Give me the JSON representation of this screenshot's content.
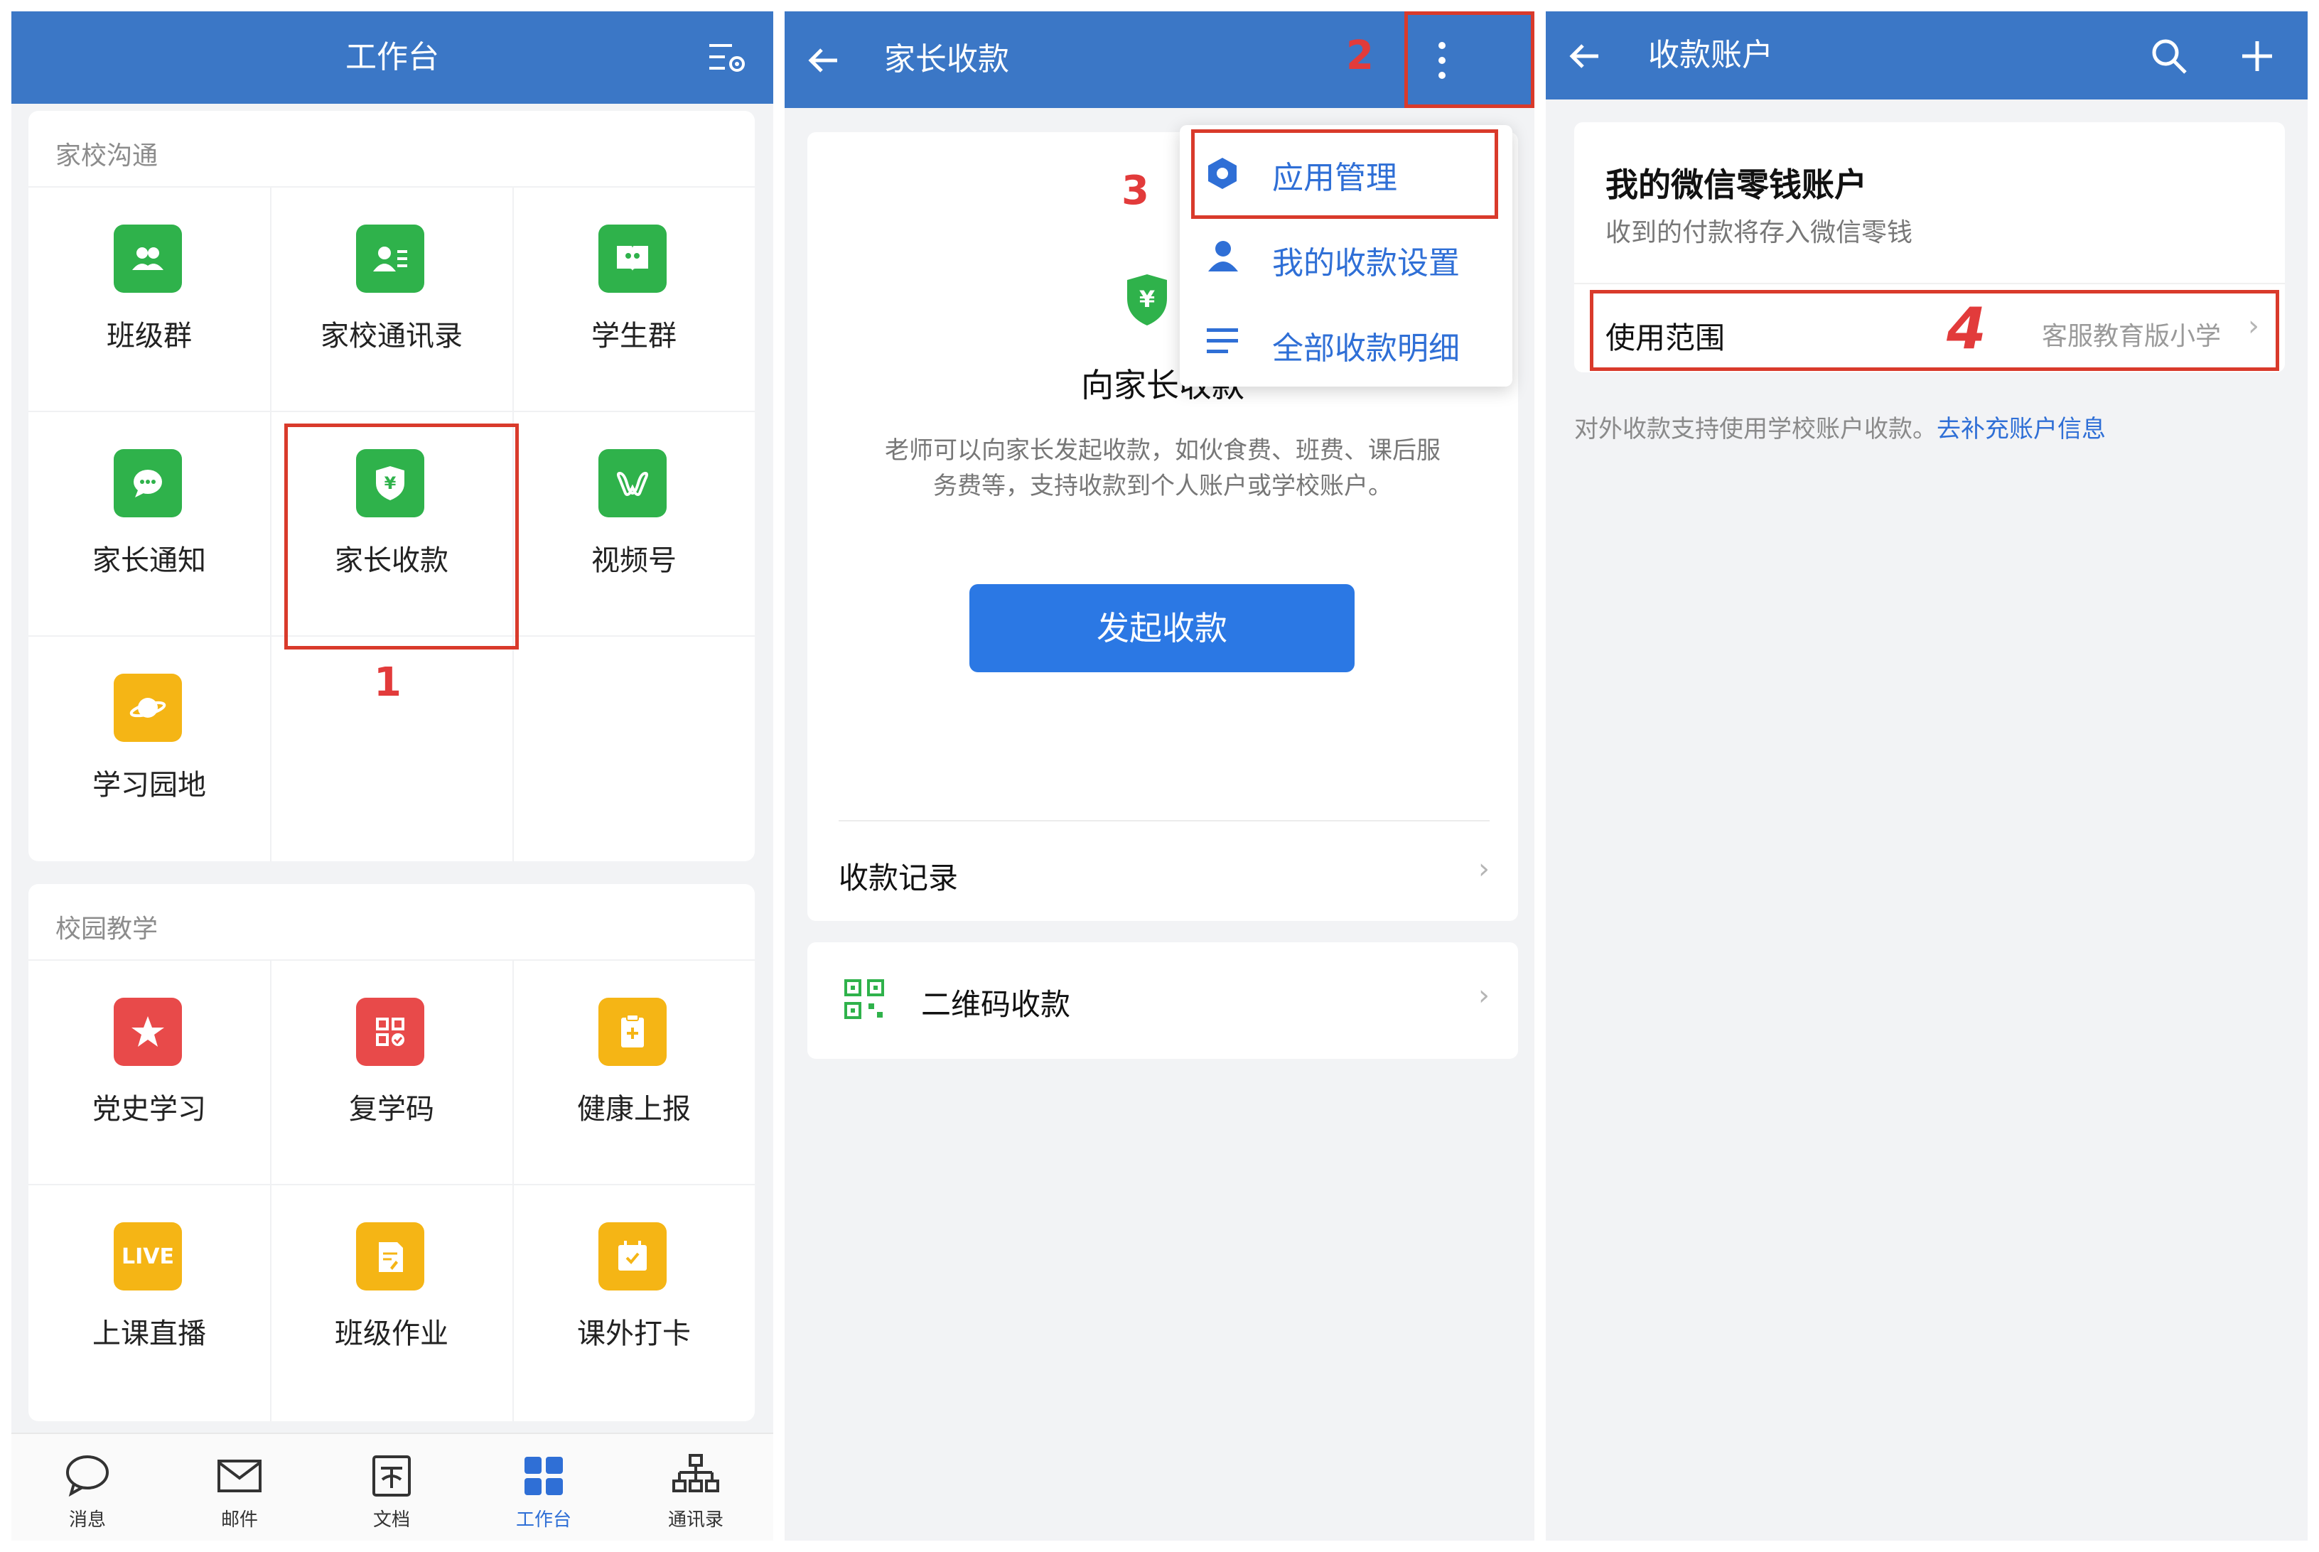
{
  "panel1": {
    "header_title": "工作台",
    "section1_title": "家校沟通",
    "section1_tiles": [
      {
        "label": "班级群",
        "icon": "class-group-icon",
        "color": "#2fb24b"
      },
      {
        "label": "家校通讯录",
        "icon": "contacts-icon",
        "color": "#2fb24b"
      },
      {
        "label": "学生群",
        "icon": "student-group-icon",
        "color": "#2fb24b"
      },
      {
        "label": "家长通知",
        "icon": "notice-chat-icon",
        "color": "#2fb24b"
      },
      {
        "label": "家长收款",
        "icon": "payment-shield-icon",
        "color": "#2fb24b"
      },
      {
        "label": "视频号",
        "icon": "channels-icon",
        "color": "#2fb24b"
      },
      {
        "label": "学习园地",
        "icon": "planet-icon",
        "color": "#f5b515"
      }
    ],
    "section2_title": "校园教学",
    "section2_tiles": [
      {
        "label": "党史学习",
        "icon": "star-icon",
        "color": "#e84a4a"
      },
      {
        "label": "复学码",
        "icon": "qr-check-icon",
        "color": "#e84a4a"
      },
      {
        "label": "健康上报",
        "icon": "clipboard-plus-icon",
        "color": "#f5b515"
      },
      {
        "label": "上课直播",
        "icon": "live-icon",
        "color": "#f5b515",
        "badge": "LIVE"
      },
      {
        "label": "班级作业",
        "icon": "homework-icon",
        "color": "#f5b515"
      },
      {
        "label": "课外打卡",
        "icon": "calendar-check-icon",
        "color": "#f5b515"
      }
    ],
    "step1": "1",
    "tabs": [
      {
        "label": "消息",
        "icon": "message-icon"
      },
      {
        "label": "邮件",
        "icon": "mail-icon"
      },
      {
        "label": "文档",
        "icon": "document-icon"
      },
      {
        "label": "工作台",
        "icon": "workbench-icon",
        "active": true
      },
      {
        "label": "通讯录",
        "icon": "org-chart-icon"
      }
    ]
  },
  "panel2": {
    "header_title": "家长收款",
    "step2": "2",
    "step3": "3",
    "menu": [
      {
        "label": "应用管理",
        "icon": "hexagon-settings-icon"
      },
      {
        "label": "我的收款设置",
        "icon": "person-icon"
      },
      {
        "label": "全部收款明细",
        "icon": "list-icon"
      }
    ],
    "hero_title": "向家长收款",
    "hero_desc_line1": "老师可以向家长发起收款，如伙食费、班费、课后服",
    "hero_desc_line2": "务费等，支持收款到个人账户或学校账户。",
    "primary_button": "发起收款",
    "records_label": "收款记录",
    "qr_label": "二维码收款"
  },
  "panel3": {
    "header_title": "收款账户",
    "account_title": "我的微信零钱账户",
    "account_subtitle": "收到的付款将存入微信零钱",
    "scope_label": "使用范围",
    "scope_value": "客服教育版小学",
    "step4": "4",
    "note_text": "对外收款支持使用学校账户收款。",
    "note_link": "去补充账户信息"
  },
  "colors": {
    "header_blue": "#3b77c6",
    "accent_blue": "#2b78e4",
    "annotation_red": "#d93a2b",
    "green": "#2fb24b",
    "yellow": "#f5b515",
    "red": "#e84a4a"
  }
}
